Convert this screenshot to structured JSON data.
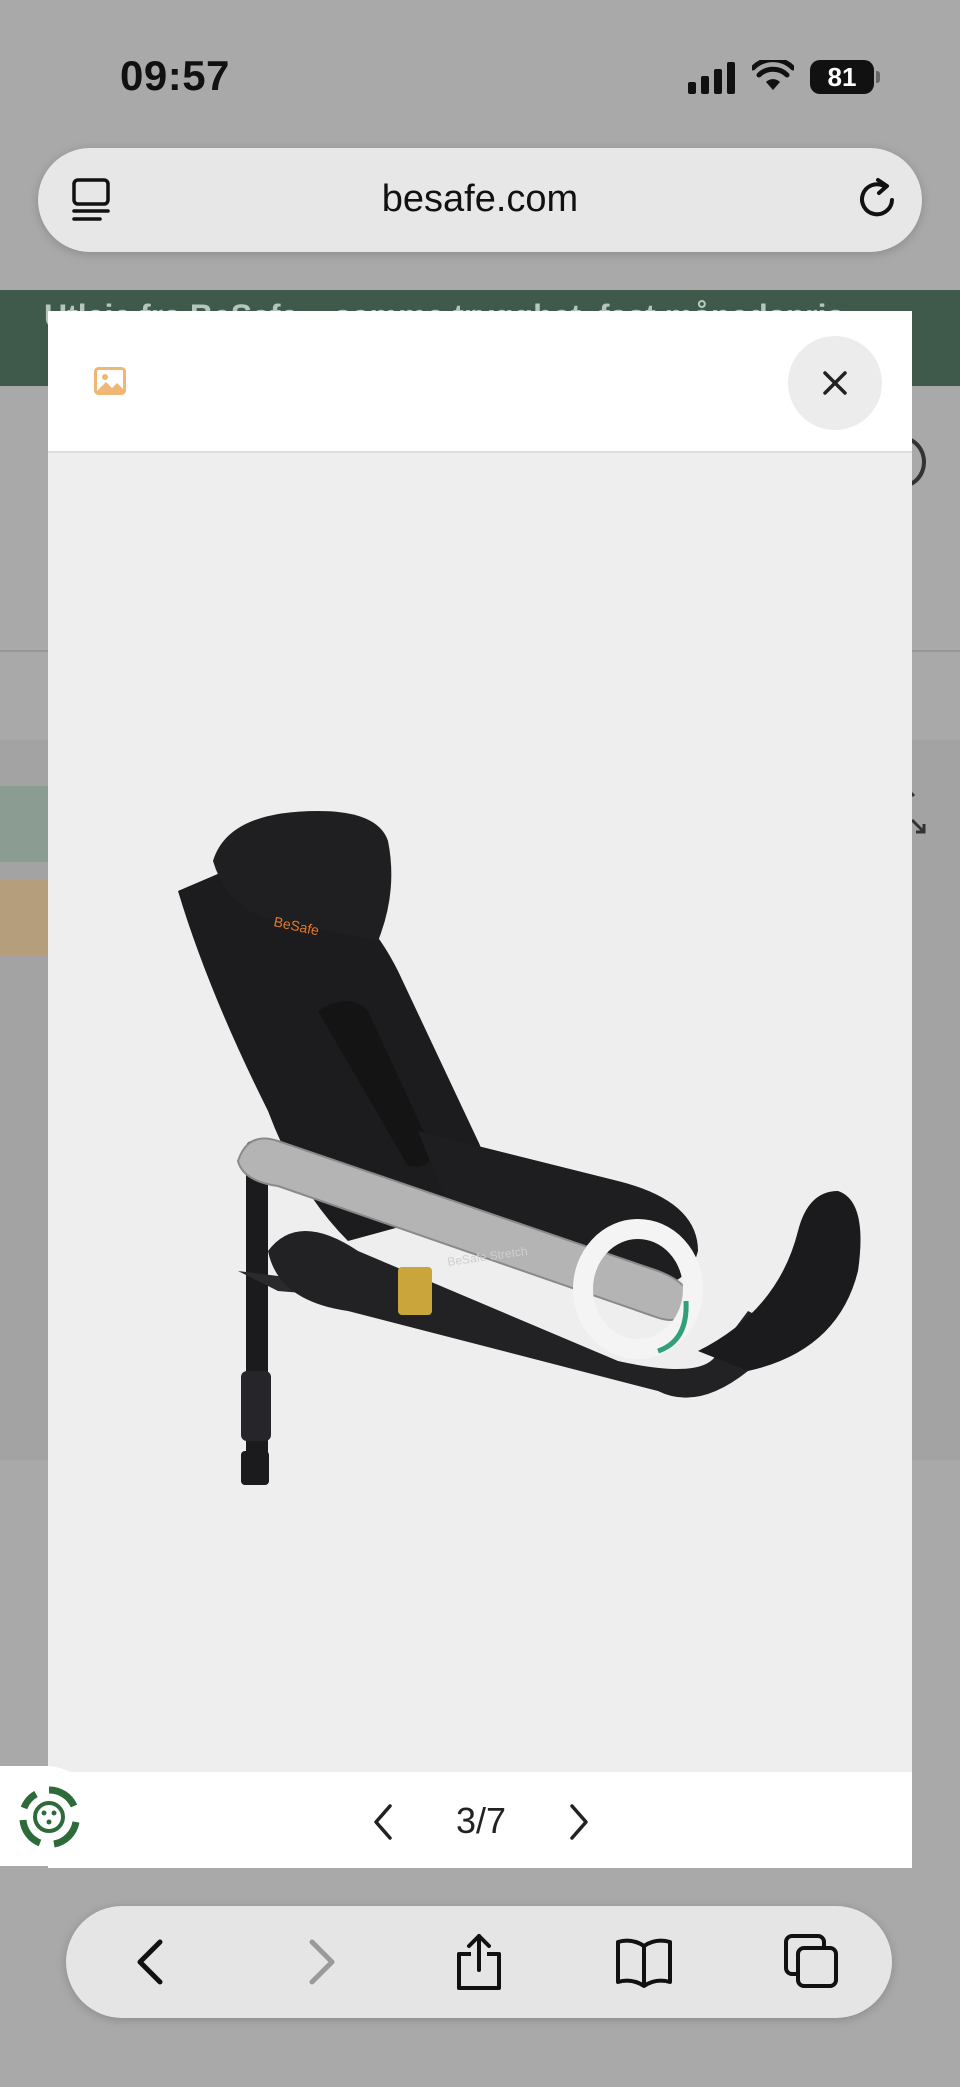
{
  "status_bar": {
    "time": "09:57",
    "battery": "81"
  },
  "browser": {
    "url": "besafe.com"
  },
  "background_page": {
    "promo_text": "Utleie fra BeSafe – samme trygghet, fast månedspris"
  },
  "modal": {
    "pager": {
      "current": 3,
      "total": 7,
      "text": "3/7"
    },
    "product_image": {
      "subject": "BeSafe Stretch car seat",
      "brand_mark": "BeSafe",
      "base_label": "BeSafe Stretch",
      "color": "#1b1b1d"
    }
  },
  "icons": {
    "tabs_menu": "tabs-menu-icon",
    "reload": "reload-icon",
    "image": "image-icon",
    "close": "close-icon",
    "prev": "chevron-left-icon",
    "next": "chevron-right-icon",
    "accessibility": "accessibility-icon",
    "back": "back-icon",
    "forward": "forward-icon",
    "share": "share-icon",
    "bookmarks": "book-icon",
    "tabs": "tabs-icon"
  },
  "colors": {
    "accent_green": "#3f5a4b",
    "image_icon_orange": "#f0b774",
    "widget_green": "#2e6b3a"
  }
}
